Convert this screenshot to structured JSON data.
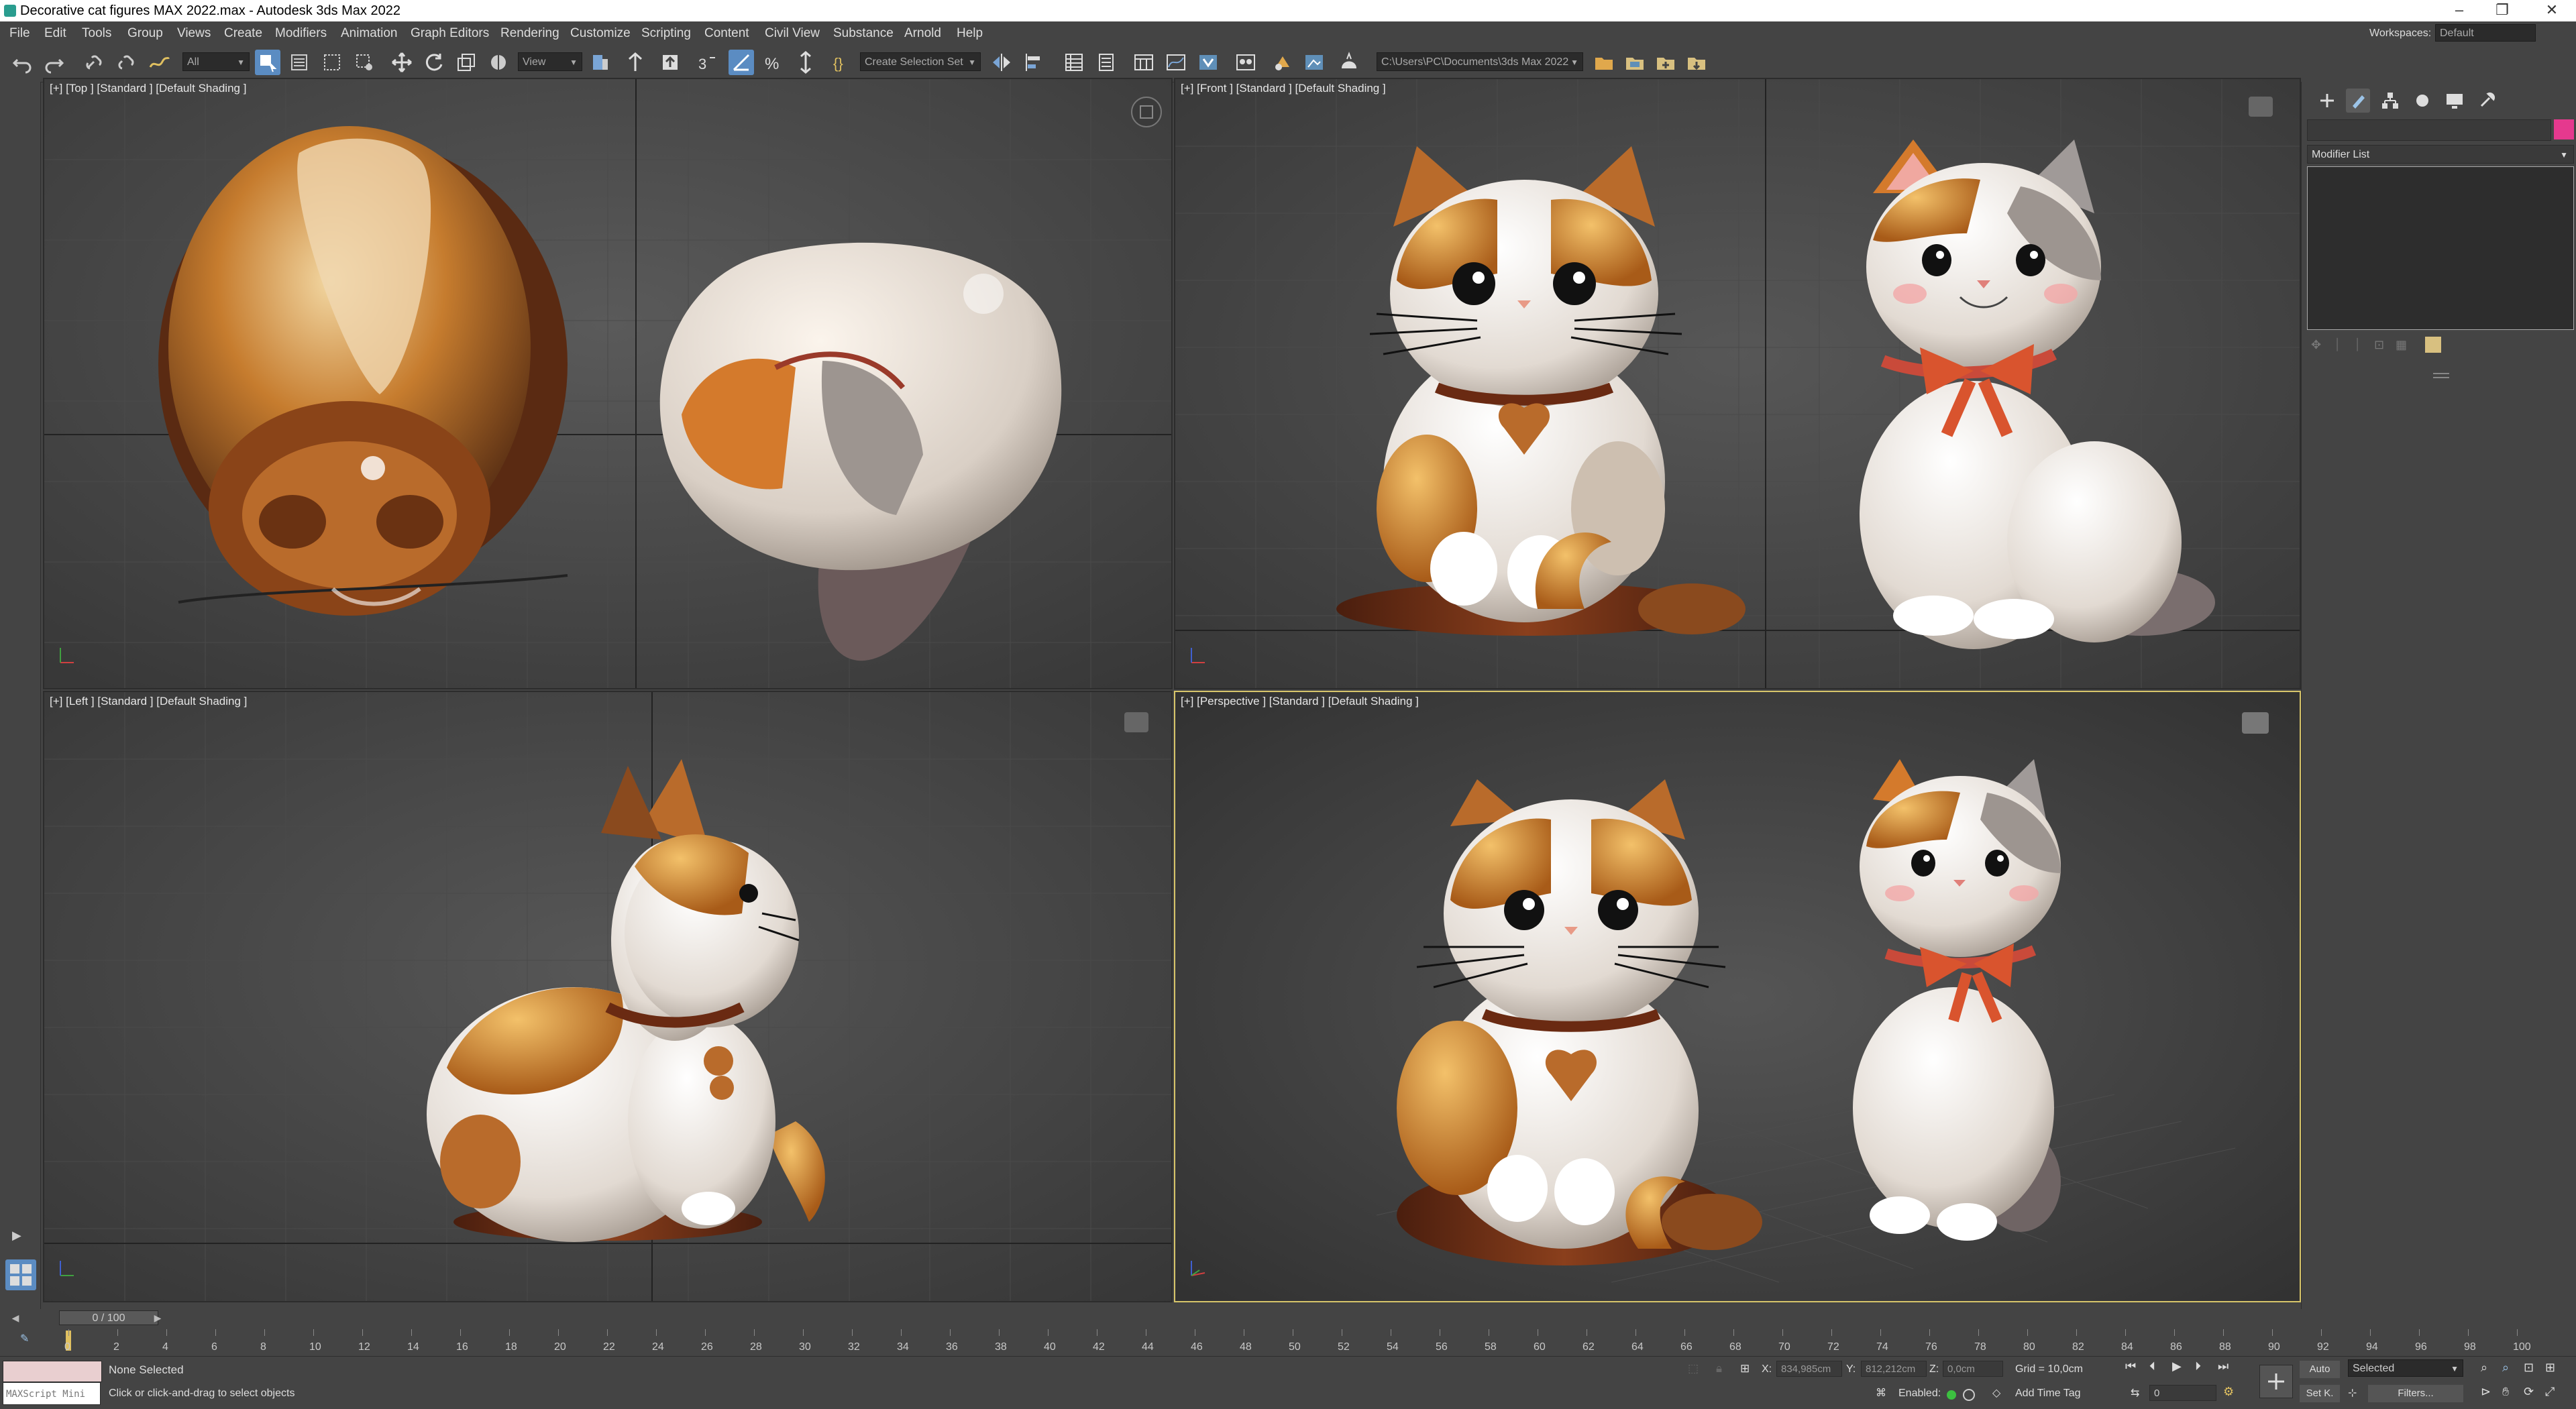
{
  "window": {
    "title": "Decorative cat figures MAX 2022.max - Autodesk 3ds Max 2022",
    "workspaces_label": "Workspaces:",
    "workspaces_value": "Default"
  },
  "menu": [
    "File",
    "Edit",
    "Tools",
    "Group",
    "Views",
    "Create",
    "Modifiers",
    "Animation",
    "Graph Editors",
    "Rendering",
    "Customize",
    "Scripting",
    "Content",
    "Civil View",
    "Substance",
    "Arnold",
    "Help"
  ],
  "toolbar": {
    "selection_filter": "All",
    "ref_coord": "View",
    "selection_set": "Create Selection Set",
    "project_path": "C:\\Users\\PC\\Documents\\3ds Max 2022"
  },
  "viewports": {
    "top": {
      "label": "[+] [Top ] [Standard ] [Default Shading ]"
    },
    "front": {
      "label": "[+] [Front ] [Standard ] [Default Shading ]"
    },
    "left": {
      "label": "[+] [Left ] [Standard ] [Default Shading ]"
    },
    "perspective": {
      "label": "[+] [Perspective ] [Standard ] [Default Shading ]"
    }
  },
  "command_panel": {
    "modifier_list": "Modifier List",
    "accent_color": "#e5398e"
  },
  "timeline": {
    "frame_display": "0 / 100",
    "ticks": [
      "0",
      "2",
      "4",
      "6",
      "8",
      "10",
      "12",
      "14",
      "16",
      "18",
      "20",
      "22",
      "24",
      "26",
      "28",
      "30",
      "32",
      "34",
      "36",
      "38",
      "40",
      "42",
      "44",
      "46",
      "48",
      "50",
      "52",
      "54",
      "56",
      "58",
      "60",
      "62",
      "64",
      "66",
      "68",
      "70",
      "72",
      "74",
      "76",
      "78",
      "80",
      "82",
      "84",
      "86",
      "88",
      "90",
      "92",
      "94",
      "96",
      "98",
      "100"
    ]
  },
  "status": {
    "maxscript_label": "MAXScript Mini",
    "selection": "None Selected",
    "prompt": "Click or click-and-drag to select objects",
    "x_label": "X:",
    "x_value": "834,985cm",
    "y_label": "Y:",
    "y_value": "812,212cm",
    "z_label": "Z:",
    "z_value": "0,0cm",
    "grid": "Grid = 10,0cm",
    "enabled": "Enabled:",
    "add_time_tag": "Add Time Tag",
    "auto_key": "Auto",
    "set_key": "Set K.",
    "key_filter": "Selected",
    "filters": "Filters...",
    "current_frame": "0"
  }
}
